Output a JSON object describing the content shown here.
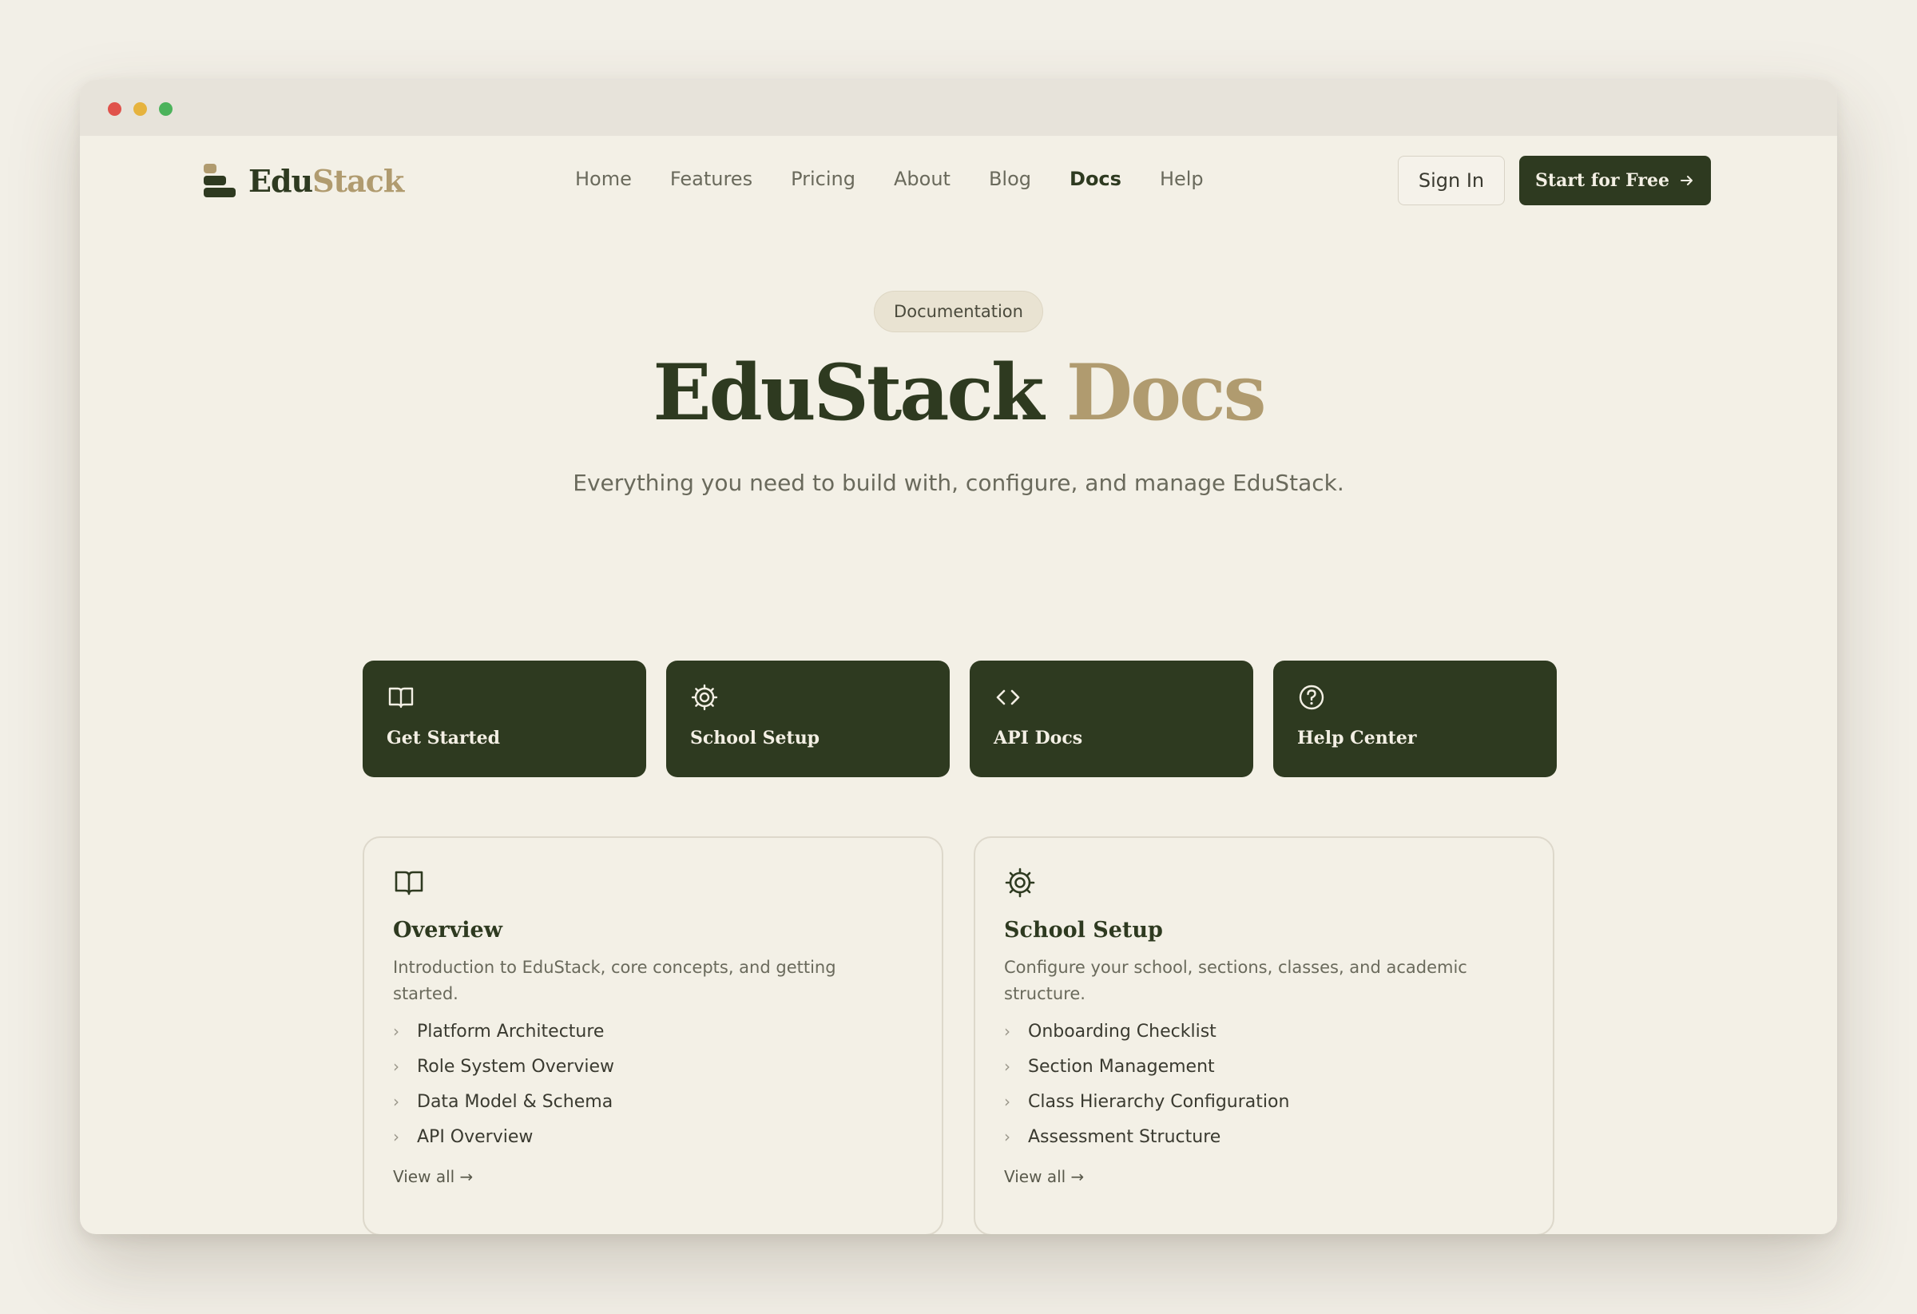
{
  "window": {
    "controls": [
      "close",
      "minimize",
      "maximize"
    ]
  },
  "brand": {
    "name_part1": "Edu",
    "name_part2": "Stack"
  },
  "nav": {
    "items": [
      {
        "label": "Home"
      },
      {
        "label": "Features"
      },
      {
        "label": "Pricing"
      },
      {
        "label": "About"
      },
      {
        "label": "Blog"
      },
      {
        "label": "Docs",
        "active": true
      },
      {
        "label": "Help"
      }
    ],
    "signin_label": "Sign In",
    "cta_label": "Start for Free",
    "cta_icon": "arrow-right-icon"
  },
  "hero": {
    "badge": "Documentation",
    "title_part1": "EduStack",
    "title_part2": "Docs",
    "subtitle": "Everything you need to build with, configure, and manage EduStack."
  },
  "quick_links": [
    {
      "label": "Get Started",
      "icon": "book-icon"
    },
    {
      "label": "School Setup",
      "icon": "gear-icon"
    },
    {
      "label": "API Docs",
      "icon": "code-icon"
    },
    {
      "label": "Help Center",
      "icon": "help-circle-icon"
    }
  ],
  "sections": [
    {
      "icon": "book-icon",
      "title": "Overview",
      "description": "Introduction to EduStack, core concepts, and getting started.",
      "links": [
        "Platform Architecture",
        "Role System Overview",
        "Data Model & Schema",
        "API Overview"
      ],
      "view_all": "View all →"
    },
    {
      "icon": "gear-icon",
      "title": "School Setup",
      "description": "Configure your school, sections, classes, and academic structure.",
      "links": [
        "Onboarding Checklist",
        "Section Management",
        "Class Hierarchy Configuration",
        "Assessment Structure"
      ],
      "view_all": "View all →"
    }
  ],
  "colors": {
    "background": "#f2efe7",
    "primary_dark": "#2e3a20",
    "accent_gold": "#b09b6f",
    "muted_text": "#6a6a5c"
  }
}
